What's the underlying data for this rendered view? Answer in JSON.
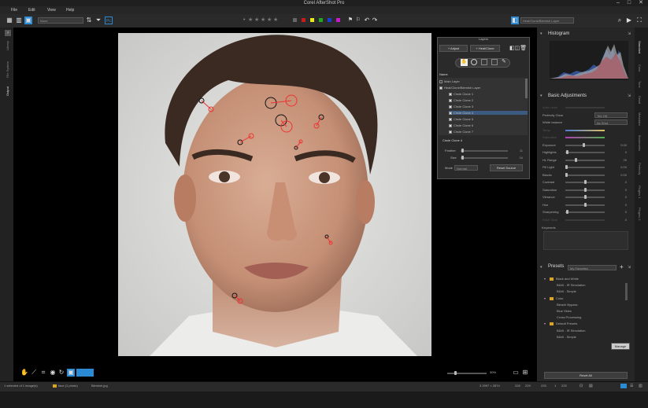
{
  "app": {
    "title": "Corel AfterShot Pro"
  },
  "menu": [
    "File",
    "Edit",
    "View",
    "Help"
  ],
  "toolbar": {
    "left_dropdown": "None",
    "right_dropdown": "Heal/Clone/Blemish Layer",
    "stars": [
      "★",
      "★",
      "★",
      "★",
      "★"
    ],
    "color_labels": [
      "#cc1a1a",
      "#e8e81a",
      "#1fa81f",
      "#1a3fd0",
      "#c81ac8"
    ]
  },
  "left_tabs": [
    "Library",
    "File System",
    "Output"
  ],
  "photo": {
    "clone_circles_overlay": true
  },
  "layers_panel": {
    "title": "Layers",
    "add_button": "Adjust",
    "heal_button": "Heal/Clone",
    "column_header": "Name",
    "items": [
      {
        "label": "Main Layer",
        "checked": false,
        "level": 0
      },
      {
        "label": "Heal/Clone/Blemish Layer",
        "checked": true,
        "level": 0
      },
      {
        "label": "Circle Clone 1",
        "checked": true,
        "level": 1
      },
      {
        "label": "Circle Clone 2",
        "checked": true,
        "level": 1
      },
      {
        "label": "Circle Clone 3",
        "checked": true,
        "level": 1
      },
      {
        "label": "Circle Clone 4",
        "checked": true,
        "level": 1
      },
      {
        "label": "Circle Clone 5",
        "checked": true,
        "level": 1
      },
      {
        "label": "Circle Clone 6",
        "checked": true,
        "level": 1
      },
      {
        "label": "Circle Clone 7",
        "checked": true,
        "level": 1
      }
    ],
    "selected_title": "Circle Clone 4",
    "feather_label": "Feather",
    "feather_value": "11",
    "size_label": "Size",
    "size_value": "34",
    "mode_label": "Mode",
    "mode_value": "Normal",
    "reset_button": "Reset Source"
  },
  "right_panel": {
    "histogram_title": "Histogram",
    "basic_title": "Basic Adjustments",
    "rows": [
      {
        "label": "Auto Level",
        "value": "",
        "dim": true
      },
      {
        "label": "Perfectly Clear",
        "value": "Tint Off",
        "dim": false
      },
      {
        "label": "White balance",
        "value": "As Shot",
        "dim": false
      },
      {
        "label": "Temp",
        "value": "",
        "dim": true
      },
      {
        "label": "Saturation",
        "value": "",
        "dim": true
      },
      {
        "label": "Exposure",
        "value": "0.00",
        "dim": false
      },
      {
        "label": "Highlights",
        "value": "0",
        "dim": false
      },
      {
        "label": "HL Range",
        "value": "25",
        "dim": false
      },
      {
        "label": "Fill Light",
        "value": "0.00",
        "dim": false
      },
      {
        "label": "Blacks",
        "value": "0.00",
        "dim": false
      },
      {
        "label": "Contrast",
        "value": "0",
        "dim": false
      },
      {
        "label": "Saturation",
        "value": "0",
        "dim": false
      },
      {
        "label": "Vibrance",
        "value": "0",
        "dim": false
      },
      {
        "label": "Hue",
        "value": "0",
        "dim": false
      },
      {
        "label": "Sharpening",
        "value": "0",
        "dim": false
      },
      {
        "label": "RAW Tone",
        "value": "0",
        "dim": true
      }
    ],
    "keywords_label": "Keywords",
    "presets_title": "Presets",
    "presets_dropdown": "My Favorites",
    "presets_tree": [
      {
        "label": "Black and White",
        "folder": true
      },
      {
        "label": "B&W - IR Simulation",
        "folder": false
      },
      {
        "label": "B&W - Simple",
        "folder": false
      },
      {
        "label": "Color",
        "folder": true
      },
      {
        "label": "Bleach Bypass",
        "folder": false
      },
      {
        "label": "Blue Skies",
        "folder": false
      },
      {
        "label": "Cross Processing",
        "folder": false
      },
      {
        "label": "Default Presets",
        "folder": true
      },
      {
        "label": "B&W - IR Simulation",
        "folder": false
      },
      {
        "label": "B&W - Simple",
        "folder": false
      }
    ],
    "manage_button": "Manage",
    "reset_all_button": "Reset All"
  },
  "right_tabs": [
    "Standard",
    "Color",
    "Tone",
    "Detail",
    "Metadata",
    "Bookmarks",
    "Perfectly",
    "Plugins 1",
    "Plugins 2"
  ],
  "zoom": {
    "value": "30%"
  },
  "status": {
    "selection": "1 selected of 1 image(s)",
    "folder": "face (1 photo)",
    "filename": "Blemish.jpg",
    "dims": "3 2997 × 2874",
    "r": "226",
    "g": "229",
    "b": "225",
    "x": "1",
    "y": "225"
  }
}
